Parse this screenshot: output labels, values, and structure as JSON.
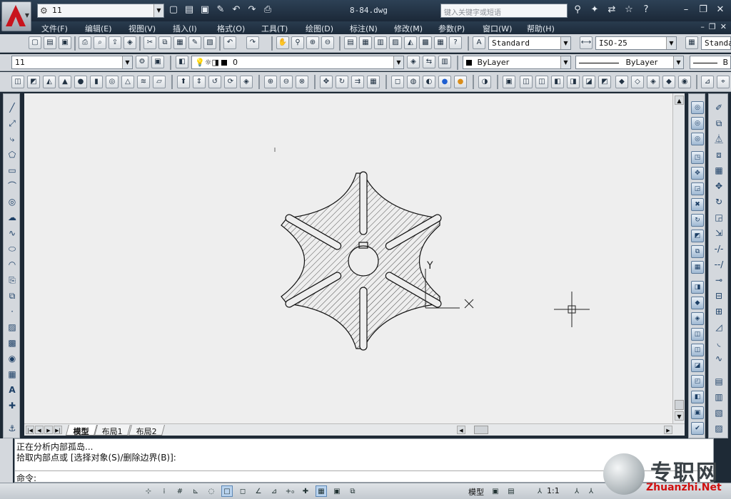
{
  "title_bar": {
    "workspace": "11",
    "document": "8-84.dwg",
    "search_placeholder": "键入关键字或短语"
  },
  "menu": [
    "文件(F)",
    "编辑(E)",
    "视图(V)",
    "插入(I)",
    "格式(O)",
    "工具(T)",
    "绘图(D)",
    "标注(N)",
    "修改(M)",
    "参数(P)",
    "窗口(W)",
    "帮助(H)"
  ],
  "styles_toolbar": {
    "text_style": "Standard",
    "dim_style": "ISO-25",
    "table_style": "Standa"
  },
  "layers_toolbar": {
    "workspace_combo": "11",
    "layer_combo": "0",
    "color_combo": "ByLayer",
    "linetype_combo": "ByLayer",
    "lineweight_combo": "B"
  },
  "layout_tabs": [
    "模型",
    "布局1",
    "布局2"
  ],
  "command": {
    "history": [
      "正在分析内部孤岛...",
      "拾取内部点或 [选择对象(S)/删除边界(B)]:"
    ],
    "prompt": "命令:"
  },
  "status": {
    "model_label": "模型",
    "scale": "1:1"
  },
  "canvas": {
    "ucs_y_label": "Y",
    "ucs_x_label": "X"
  },
  "watermark": {
    "name": "专职网",
    "url": "Zhuanzhi.Net"
  },
  "colors": {
    "canvas_bg": "#eeeeee",
    "frame": "#1e2a36",
    "toolbar": "#d4d8dd"
  }
}
